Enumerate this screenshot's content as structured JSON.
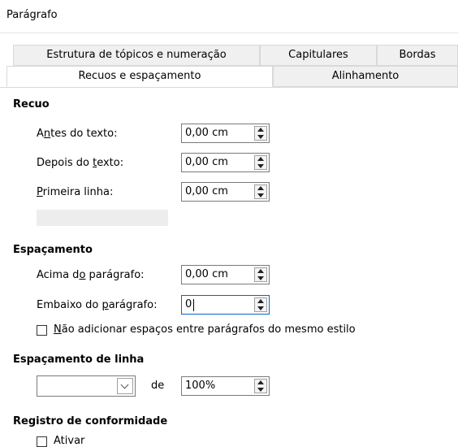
{
  "window": {
    "title": "Parágrafo"
  },
  "tabs": {
    "row1": [
      "Estrutura de tópicos e numeração",
      "Capitulares",
      "Bordas"
    ],
    "row2": [
      "Recuos e espaçamento",
      "Alinhamento"
    ]
  },
  "recuo": {
    "title": "Recuo",
    "antes": {
      "label_pre": "A",
      "label_u": "n",
      "label_post": "tes do texto:",
      "value": "0,00 cm"
    },
    "depois": {
      "label_pre": "Depois do ",
      "label_u": "t",
      "label_post": "exto:",
      "value": "0,00 cm"
    },
    "primeira": {
      "label_pre": "",
      "label_u": "P",
      "label_post": "rimeira linha:",
      "value": "0,00 cm"
    }
  },
  "espacamento": {
    "title": "Espaçamento",
    "acima": {
      "label_pre": "Acima d",
      "label_u": "o",
      "label_post": " parágrafo:",
      "value": "0,00 cm"
    },
    "embaixo": {
      "label_pre": "Embaixo do ",
      "label_u": "p",
      "label_post": "arágrafo:",
      "value": "0"
    },
    "nao_adicionar": {
      "label_u": "N",
      "label_post": "ão adicionar espaços entre parágrafos do mesmo estilo",
      "checked": false
    }
  },
  "linha": {
    "title": "Espaçamento de linha",
    "dropdown_value": "",
    "de_label": "de",
    "value": "100%"
  },
  "registro": {
    "title": "Registro de conformidade",
    "ativar_label": "Ativar"
  }
}
